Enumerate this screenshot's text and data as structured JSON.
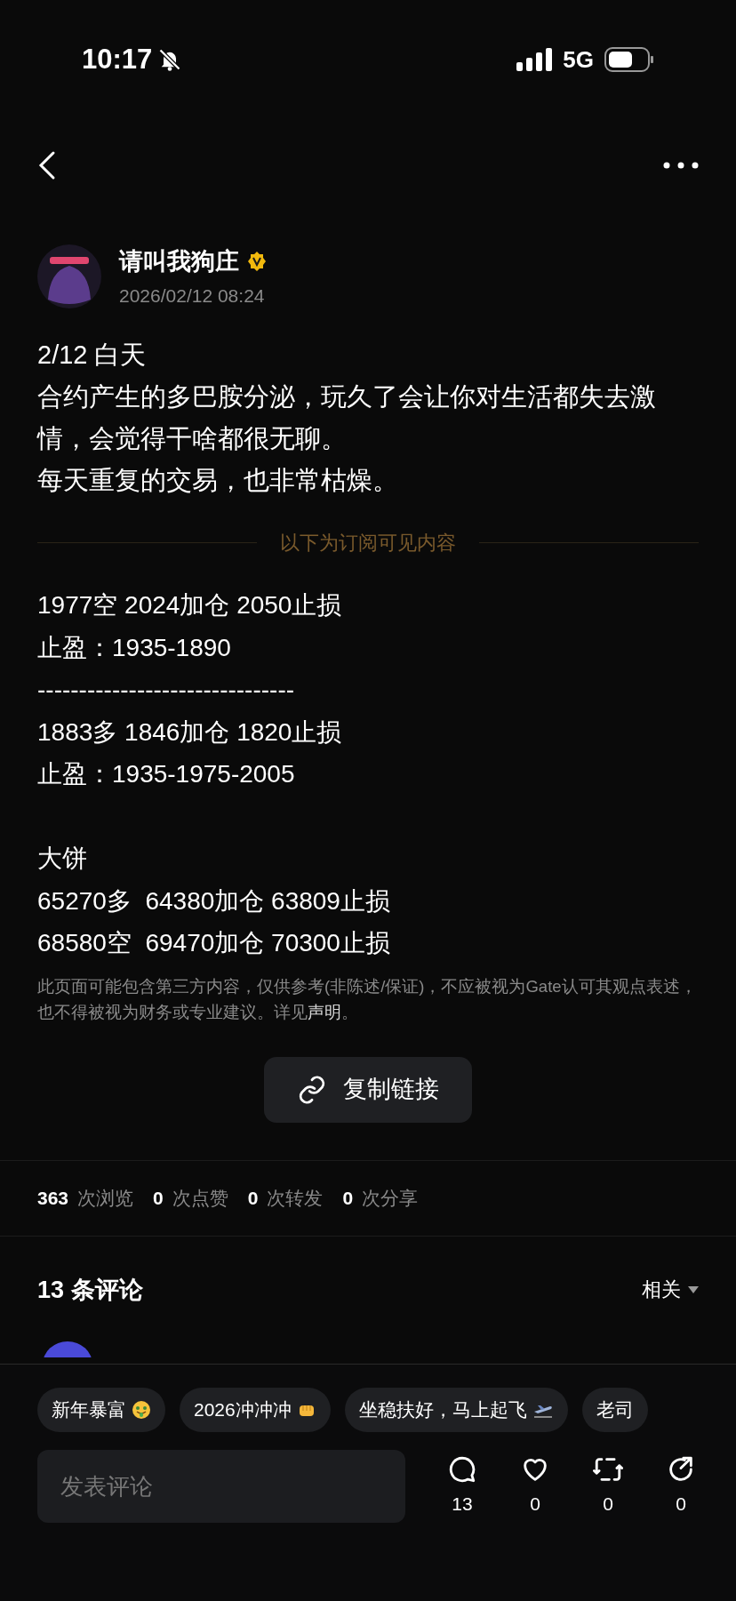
{
  "status_bar": {
    "time": "10:17",
    "network": "5G"
  },
  "author": {
    "name": "请叫我狗庄",
    "verified": true,
    "date": "2026/02/12 08:24"
  },
  "intro": [
    "2/12 白天",
    "合约产生的多巴胺分泌，玩久了会让你对生活都失去激情，会觉得干啥都很无聊。",
    "每天重复的交易，也非常枯燥。"
  ],
  "subscriber_divider": "以下为订阅可见内容",
  "content_blocks": [
    [
      "1977空 2024加仓 2050止损",
      "止盈：1935-1890",
      "-------------------------------",
      "1883多 1846加仓 1820止损",
      "止盈：1935-1975-2005"
    ],
    [
      "大饼",
      "65270多  64380加仓 63809止损",
      "68580空  69470加仓 70300止损"
    ]
  ],
  "disclaimer": {
    "text": "此页面可能包含第三方内容，仅供参考(非陈述/保证)，不应被视为Gate认可其观点表述，也不得被视为财务或专业建议。详见",
    "link": "声明",
    "end": "。"
  },
  "copy_button": "复制链接",
  "stats": [
    {
      "count": "363",
      "label": "次浏览"
    },
    {
      "count": "0",
      "label": "次点赞"
    },
    {
      "count": "0",
      "label": "次转发"
    },
    {
      "count": "0",
      "label": "次分享"
    }
  ],
  "comments": {
    "title": "13 条评论",
    "sort": "相关"
  },
  "quick_replies": [
    {
      "text": "新年暴富",
      "kind": "money"
    },
    {
      "text": "2026冲冲冲",
      "kind": "fist"
    },
    {
      "text": "坐稳扶好，马上起飞",
      "kind": "plane"
    },
    {
      "text": "老司",
      "kind": "plain"
    }
  ],
  "comment_input": {
    "placeholder": "发表评论"
  },
  "actions": [
    {
      "kind": "comment",
      "count": "13"
    },
    {
      "kind": "like",
      "count": "0"
    },
    {
      "kind": "repost",
      "count": "0"
    },
    {
      "kind": "share",
      "count": "0"
    }
  ]
}
